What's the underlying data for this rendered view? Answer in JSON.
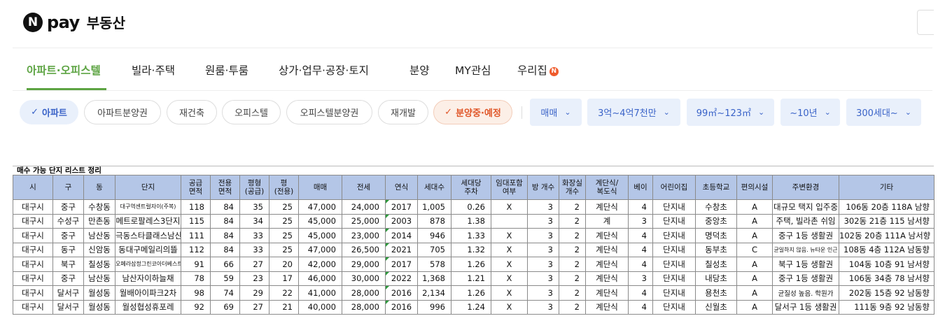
{
  "header": {
    "logo_badge": "N",
    "logo_pay": "pay",
    "logo_text": "부동산"
  },
  "nav": {
    "items": [
      "아파트·오피스텔",
      "빌라·주택",
      "원룸·투룸",
      "상가·업무·공장·토지",
      "분양",
      "MY관심",
      "우리집"
    ],
    "new_badge": "N",
    "active_color": "#5da443"
  },
  "filters": {
    "chips": [
      "아파트",
      "아파트분양권",
      "재건축",
      "오피스텔",
      "오피스텔분양권",
      "재개발",
      "분양중·예정"
    ],
    "checkmark": "✓",
    "dropdowns": [
      "매매",
      "3억~4억7천만",
      "99㎡~123㎡",
      "~10년",
      "300세대~"
    ],
    "chevron": "⌄",
    "colors": {
      "blue": "#3a63c8",
      "blue_bg": "#e9f0fb",
      "orange": "#e0572a"
    }
  },
  "sheet": {
    "title": "매수 가능 단지 리스트 정리",
    "header_bg": "#b4c6e7",
    "headers": [
      "시",
      "구",
      "동",
      "단지",
      "공급\n면적",
      "전용\n면적",
      "평형\n(공급)",
      "평\n(전용)",
      "매매",
      "전세",
      "연식",
      "세대수",
      "세대당\n주차",
      "임대포함\n여부",
      "방 개수",
      "화장실\n개수",
      "계단식/\n복도식",
      "베이",
      "어린이집",
      "초등학교",
      "편의시설",
      "주변환경",
      "기타"
    ],
    "rows": [
      [
        "대구시",
        "중구",
        "수창동",
        "대구역센트럴자이(주복)",
        "118",
        "84",
        "35",
        "25",
        "47,000",
        "24,000",
        "2017",
        "1,005",
        "0.26",
        "X",
        "3",
        "2",
        "계단식",
        "4",
        "단지내",
        "수창초",
        "A",
        "대규모 택지 입주중",
        "106동 20층 118A 남향"
      ],
      [
        "대구시",
        "수성구",
        "만촌동",
        "메트로팔레스3단지",
        "115",
        "84",
        "34",
        "25",
        "45,000",
        "25,000",
        "2003",
        "878",
        "1.38",
        "",
        "3",
        "2",
        "계",
        "3",
        "단지내",
        "중앙초",
        "A",
        "주택, 빌라촌 쉬임",
        "302동 21층 115 남서향"
      ],
      [
        "대구시",
        "중구",
        "남산동",
        "극동스타클래스남산",
        "111",
        "84",
        "33",
        "25",
        "45,000",
        "23,000",
        "2014",
        "946",
        "1.33",
        "X",
        "3",
        "2",
        "계단식",
        "4",
        "단지내",
        "명덕초",
        "A",
        "중구 1등 생활권",
        "102동 20층 111A 남서향"
      ],
      [
        "대구시",
        "동구",
        "신암동",
        "동대구메일리의뜰",
        "112",
        "84",
        "33",
        "25",
        "47,000",
        "26,500",
        "2021",
        "705",
        "1.32",
        "X",
        "3",
        "2",
        "계단식",
        "4",
        "단지내",
        "동부초",
        "C",
        "균일하지 않음. 뉴타운 인근",
        "108동 4층 112A 남동향"
      ],
      [
        "대구시",
        "북구",
        "칠성동",
        "오페라삼정그린코아더베스트",
        "91",
        "66",
        "27",
        "20",
        "42,000",
        "29,000",
        "2017",
        "578",
        "1.26",
        "X",
        "3",
        "2",
        "계단식",
        "4",
        "단지내",
        "칠성초",
        "A",
        "북구 1등 생활권",
        "104동 10층 91 남서향"
      ],
      [
        "대구시",
        "중구",
        "남산동",
        "남산자이하늘채",
        "78",
        "59",
        "23",
        "17",
        "46,000",
        "30,000",
        "2022",
        "1,368",
        "1.21",
        "X",
        "3",
        "2",
        "계단식",
        "3",
        "단지내",
        "내당초",
        "A",
        "중구 1등 생활권",
        "106동 34층 78 남서향"
      ],
      [
        "대구시",
        "달서구",
        "월성동",
        "월배아이파크2차",
        "98",
        "74",
        "29",
        "22",
        "41,000",
        "28,000",
        "2016",
        "2,134",
        "1.26",
        "X",
        "3",
        "2",
        "계단식",
        "4",
        "단지내",
        "용천초",
        "A",
        "균질성 높음. 학원가",
        "202동 15층 92 남동향"
      ],
      [
        "대구시",
        "달서구",
        "월성동",
        "월성협성휴포레",
        "92",
        "69",
        "27",
        "21",
        "40,000",
        "28,000",
        "2016",
        "996",
        "1.24",
        "X",
        "3",
        "2",
        "계단식",
        "4",
        "단지내",
        "신월초",
        "A",
        "달서구 1등 생활권",
        "111동 9층 92 남동향"
      ]
    ]
  }
}
